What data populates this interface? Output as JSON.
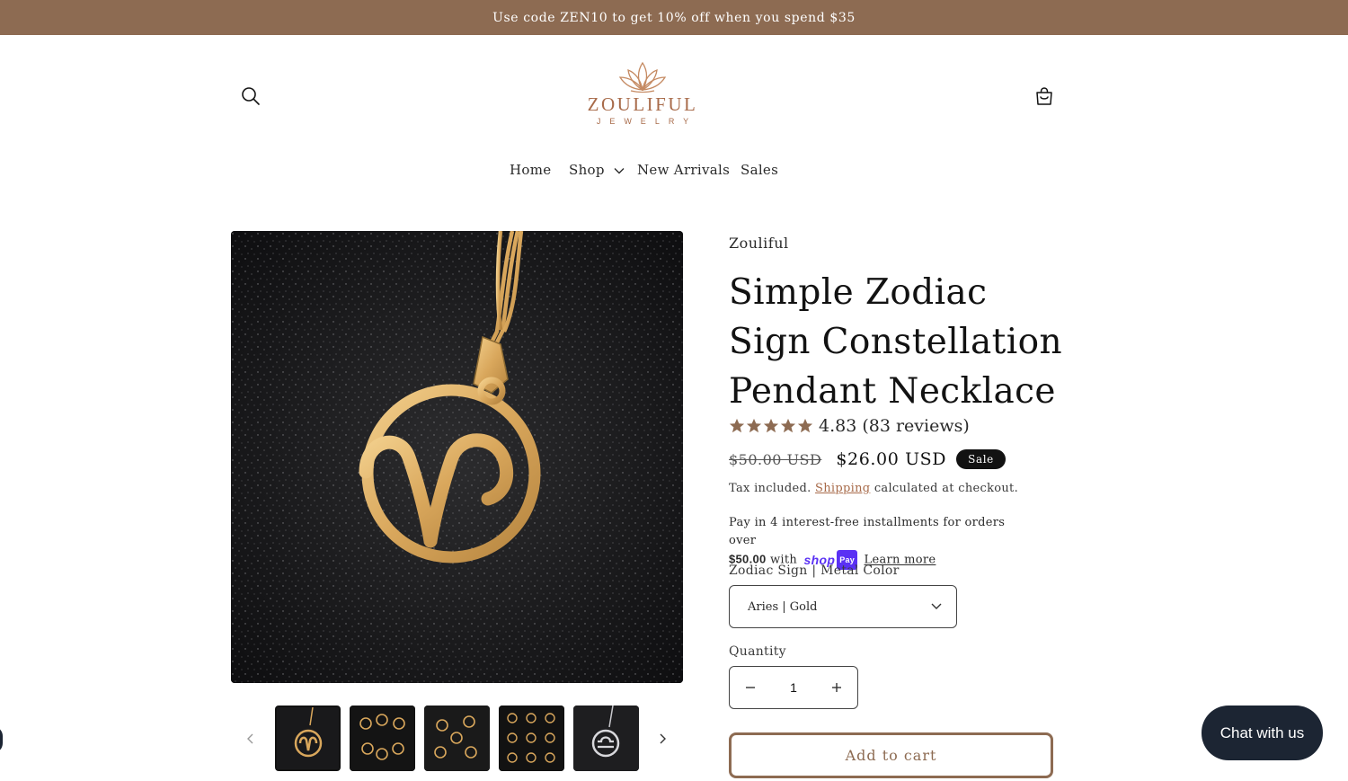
{
  "announcement": {
    "text": "Use code ZEN10 to get 10% off when you spend $35"
  },
  "header": {
    "logo_word": "ZOULIFUL",
    "logo_sub": "JEWELRY",
    "search_icon": "search-icon",
    "cart_icon": "cart-icon"
  },
  "nav": {
    "items": [
      {
        "label": "Home"
      },
      {
        "label": "Shop",
        "has_dropdown": true
      },
      {
        "label": "New Arrivals"
      },
      {
        "label": "Sales"
      }
    ]
  },
  "gallery": {
    "prev_icon": "chevron-left-icon",
    "next_icon": "chevron-right-icon",
    "active_index": 0,
    "thumbnail_count": 5
  },
  "product": {
    "vendor": "Zouliful",
    "title": "Simple Zodiac Sign Constellation Pendant Necklace",
    "rating": {
      "value": "4.83",
      "reviews": "(83 reviews)",
      "stars": 5
    },
    "price_old": "$50.00 USD",
    "price_new": "$26.00 USD",
    "badge": "Sale",
    "tax_prefix": "Tax included.",
    "tax_link": "Shipping",
    "tax_suffix": "calculated at checkout.",
    "installments_text": "Pay in 4 interest-free installments for orders over",
    "installments_amount": "$50.00",
    "installments_with": "with",
    "shop_pay_word": "shop",
    "shop_pay_box": "Pay",
    "learn_more": "Learn more",
    "variant_label": "Zodiac Sign | Metal Color",
    "variant_value": "Aries | Gold",
    "quantity_label": "Quantity",
    "quantity_value": "1",
    "add_to_cart": "Add to cart"
  },
  "chat": {
    "label": "Chat with us"
  },
  "colors": {
    "accent": "#8d6b52",
    "logo": "#a86b4a",
    "gold": "#d9a75c",
    "chat_bg": "#1c2533",
    "shop_pay": "#5a31f4"
  }
}
